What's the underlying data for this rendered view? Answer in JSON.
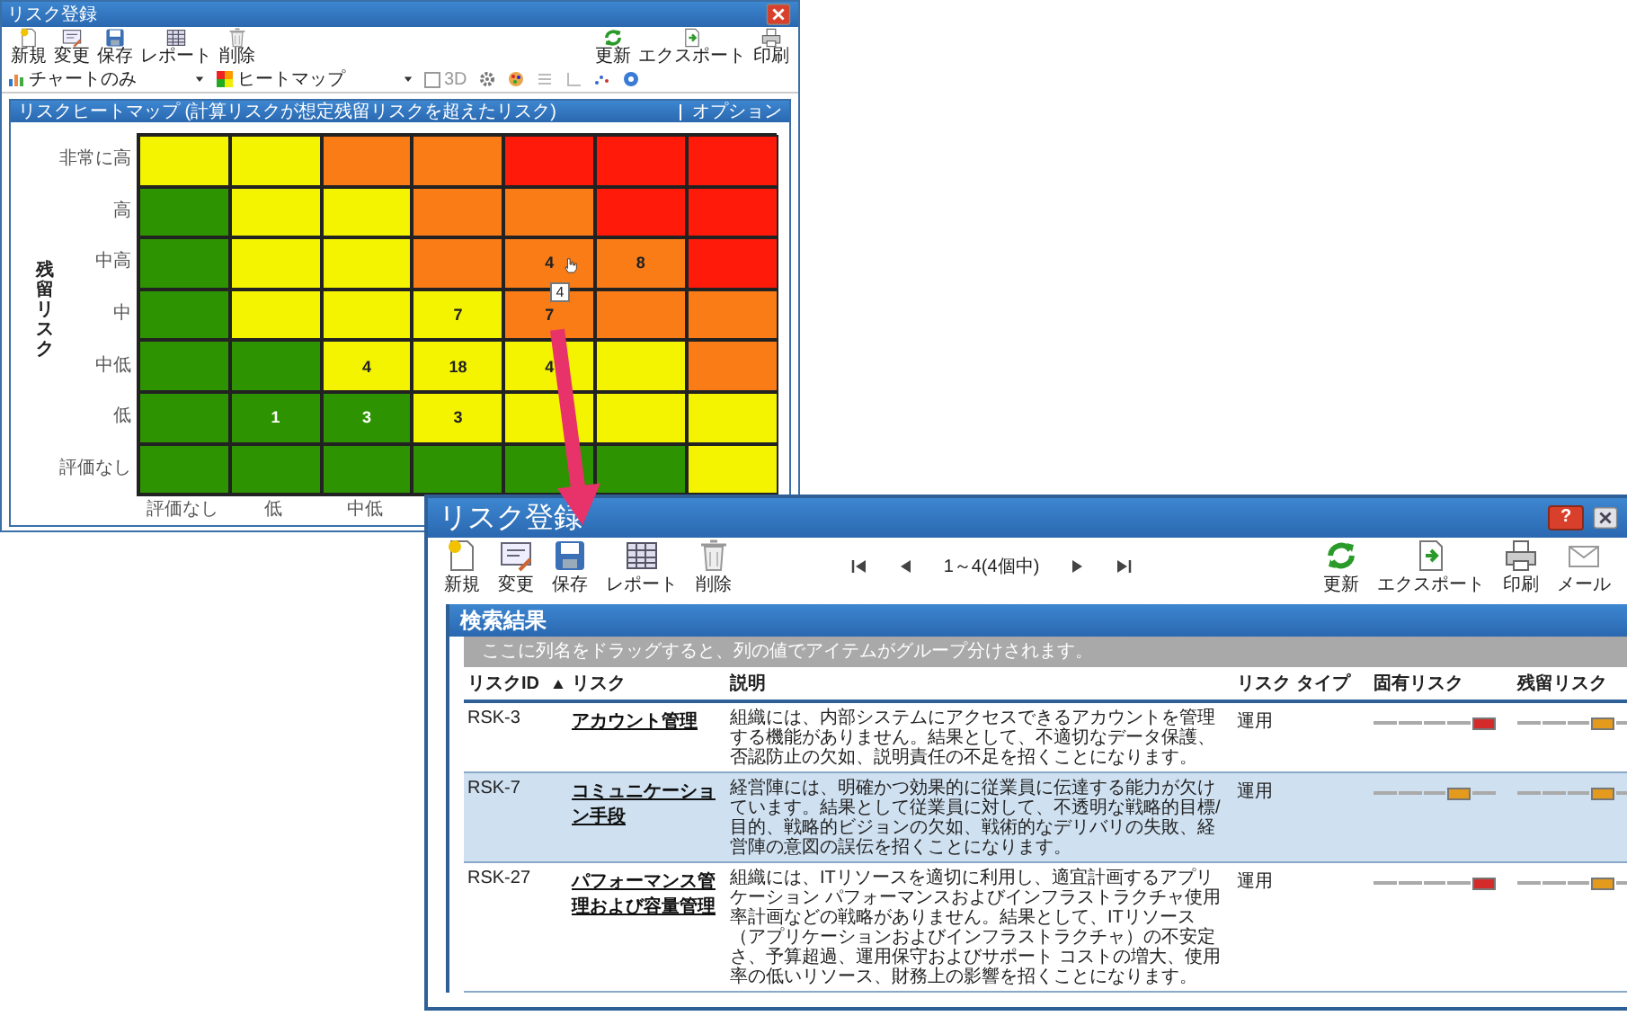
{
  "back_window": {
    "title": "リスク登録",
    "toolbar": [
      "新規",
      "変更",
      "保存",
      "レポート",
      "削除"
    ],
    "toolbar_right": [
      "更新",
      "エクスポート",
      "印刷"
    ],
    "chart_toolbar": {
      "view": "チャートのみ",
      "chart_type": "ヒートマップ",
      "option_3d": {
        "label": "3D",
        "checked": false
      }
    },
    "panel": {
      "title": "リスクヒートマップ (計算リスクが想定残留リスクを超えたリスク)",
      "options_menu": "オプション"
    },
    "heatmap": {
      "y_axis_title": "残留リスク",
      "row_labels": [
        "非常に高",
        "高",
        "中高",
        "中",
        "中低",
        "低",
        "評価なし"
      ],
      "column_labels": [
        "評価なし",
        "低",
        "中低"
      ],
      "rows": [
        [
          {
            "color": "#f4f400"
          },
          {
            "color": "#f4f400"
          },
          {
            "color": "#f97c17"
          },
          {
            "color": "#f97c17"
          },
          {
            "color": "#ff1a0a"
          },
          {
            "color": "#ff1a0a"
          },
          {
            "color": "#ff1a0a"
          }
        ],
        [
          {
            "color": "#2e9300"
          },
          {
            "color": "#f4f400"
          },
          {
            "color": "#f4f400"
          },
          {
            "color": "#f97c17"
          },
          {
            "color": "#f97c17"
          },
          {
            "color": "#ff1a0a"
          },
          {
            "color": "#ff1a0a"
          }
        ],
        [
          {
            "color": "#2e9300"
          },
          {
            "color": "#f4f400"
          },
          {
            "color": "#f4f400"
          },
          {
            "color": "#f97c17"
          },
          {
            "color": "#f97c17",
            "count": "4",
            "tooltip": "4"
          },
          {
            "color": "#f97c17",
            "count": "8"
          },
          {
            "color": "#ff1a0a"
          }
        ],
        [
          {
            "color": "#2e9300"
          },
          {
            "color": "#f4f400"
          },
          {
            "color": "#f4f400"
          },
          {
            "color": "#f4f400",
            "count": "7"
          },
          {
            "color": "#f97c17",
            "count": "7"
          },
          {
            "color": "#f97c17"
          },
          {
            "color": "#f97c17"
          }
        ],
        [
          {
            "color": "#2e9300"
          },
          {
            "color": "#2e9300"
          },
          {
            "color": "#f4f400",
            "count": "4"
          },
          {
            "color": "#f4f400",
            "count": "18"
          },
          {
            "color": "#f4f400",
            "count": "4"
          },
          {
            "color": "#f4f400"
          },
          {
            "color": "#f97c17"
          }
        ],
        [
          {
            "color": "#2e9300"
          },
          {
            "color": "#2e9300",
            "count": "1"
          },
          {
            "color": "#2e9300",
            "count": "3"
          },
          {
            "color": "#f4f400",
            "count": "3"
          },
          {
            "color": "#f4f400"
          },
          {
            "color": "#f4f400"
          },
          {
            "color": "#f4f400"
          }
        ],
        [
          {
            "color": "#2e9300"
          },
          {
            "color": "#2e9300"
          },
          {
            "color": "#2e9300"
          },
          {
            "color": "#2e9300"
          },
          {
            "color": "#2e9300"
          },
          {
            "color": "#2e9300"
          },
          {
            "color": "#f4f400"
          }
        ]
      ]
    }
  },
  "front_window": {
    "title": "リスク登録",
    "help_button": "?",
    "toolbar": [
      "新規",
      "変更",
      "保存",
      "レポート",
      "削除"
    ],
    "pager": "1～4(4個中)",
    "toolbar_right": [
      "更新",
      "エクスポート",
      "印刷",
      "メール"
    ],
    "section_title": "検索結果",
    "group_hint": "ここに列名をドラッグすると、列の値でアイテムがグループ分けされます。",
    "columns": [
      {
        "label": "リスクID",
        "sorted": true
      },
      {
        "label": "リスク",
        "sorted": false
      },
      {
        "label": "説明",
        "sorted": false
      },
      {
        "label": "リスク タイプ",
        "sorted": false
      },
      {
        "label": "固有リスク",
        "sorted": false
      },
      {
        "label": "残留リスク",
        "sorted": false
      }
    ],
    "rows": [
      {
        "id": "RSK-3",
        "risk": "アカウント管理",
        "description": "組織には、内部システムにアクセスできるアカウントを管理する機能がありません。結果として、不適切なデータ保護、否認防止の欠如、説明責任の不足を招くことになります。",
        "type": "運用",
        "inherent": [
          {
            "selected": false
          },
          {
            "selected": false
          },
          {
            "selected": false
          },
          {
            "selected": false
          },
          {
            "selected": true
          }
        ],
        "residual": [
          {
            "selected": false
          },
          {
            "selected": false
          },
          {
            "selected": false
          },
          {
            "selected": true
          },
          {
            "selected": false
          }
        ],
        "selected": false
      },
      {
        "id": "RSK-7",
        "risk": "コミュニケーション手段",
        "description": "経営陣には、明確かつ効果的に従業員に伝達する能力が欠けています。結果として従業員に対して、不透明な戦略的目標/目的、戦略的ビジョンの欠如、戦術的なデリバリの失敗、経営陣の意図の誤伝を招くことになります。",
        "type": "運用",
        "inherent": [
          {
            "selected": false
          },
          {
            "selected": false
          },
          {
            "selected": false
          },
          {
            "selected": true
          },
          {
            "selected": false
          }
        ],
        "residual": [
          {
            "selected": false
          },
          {
            "selected": false
          },
          {
            "selected": false
          },
          {
            "selected": true
          },
          {
            "selected": false
          }
        ],
        "selected": true
      },
      {
        "id": "RSK-27",
        "risk": "パフォーマンス管理および容量管理",
        "description": "組織には、ITリソースを適切に利用し、適宜計画するアプリケーション パフォーマンスおよびインフラストラクチャ使用率計画などの戦略がありません。結果として、ITリソース（アプリケーションおよびインフラストラクチャ）の不安定さ、予算超過、運用保守およびサポート コストの増大、使用率の低いリソース、財務上の影響を招くことになります。",
        "type": "運用",
        "inherent": [
          {
            "selected": false
          },
          {
            "selected": false
          },
          {
            "selected": false
          },
          {
            "selected": false
          },
          {
            "selected": true
          }
        ],
        "residual": [
          {
            "selected": false
          },
          {
            "selected": false
          },
          {
            "selected": false
          },
          {
            "selected": true
          },
          {
            "selected": false
          }
        ],
        "selected": false
      }
    ]
  }
}
